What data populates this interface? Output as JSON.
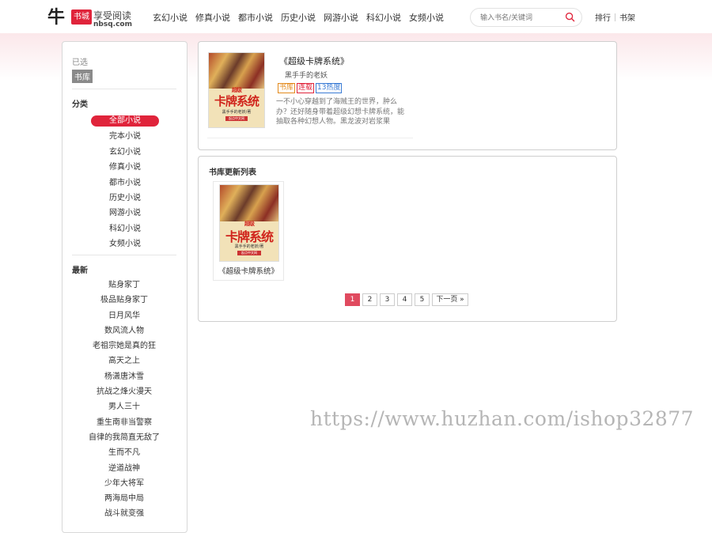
{
  "header": {
    "logo": {
      "char": "牛",
      "stamp": "书城",
      "slogan": "享受阅读",
      "domain": "nbsq.com"
    },
    "nav": [
      "玄幻小说",
      "修真小说",
      "都市小说",
      "历史小说",
      "网游小说",
      "科幻小说",
      "女频小说"
    ],
    "search": {
      "placeholder": "输入书名/关键词",
      "icon": "search-icon"
    },
    "links": {
      "rank": "排行",
      "shelf": "书架"
    }
  },
  "sidebar": {
    "selected_title": "已选",
    "selected_tag": "书库",
    "category_title": "分类",
    "categories": [
      "全部小说",
      "完本小说",
      "玄幻小说",
      "修真小说",
      "都市小说",
      "历史小说",
      "网游小说",
      "科幻小说",
      "女频小说"
    ],
    "active_category": "全部小说",
    "latest_title": "最新",
    "latest": [
      "贴身家丁",
      "极品贴身家丁",
      "日月风华",
      "数风流人物",
      "老祖宗她是真的狂",
      "高天之上",
      "杨潇唐沐雪",
      "抗战之烽火漫天",
      "男人三十",
      "重生南非当警察",
      "自律的我简直无敌了",
      "生而不凡",
      "逆道战神",
      "少年大将军",
      "两海局中局",
      "战斗就变强"
    ]
  },
  "featured": {
    "title": "《超级卡牌系统》",
    "author": "黑手手的老妖",
    "tags": [
      "书库",
      "连载",
      "13热度"
    ],
    "description": "一不小心穿越到了海贼王的世界，肿么办？还好随身带着超级幻想卡牌系统，能抽取各种幻想人物。黑龙波对岩浆果",
    "cover": {
      "top": "超级",
      "title": "卡牌系统",
      "author": "黑手手的老妖/著",
      "publisher": "起点中文网"
    }
  },
  "updates": {
    "title": "书库更新列表",
    "books": [
      {
        "name": "《超级卡牌系统》",
        "cover": {
          "top": "超级",
          "title": "卡牌系统",
          "author": "黑手手的老妖/著",
          "publisher": "起点中文网"
        }
      }
    ]
  },
  "pagination": {
    "pages": [
      "1",
      "2",
      "3",
      "4",
      "5"
    ],
    "current": "1",
    "next": "下一页 »"
  },
  "watermark": "https://www.huzhan.com/ishop32877",
  "colors": {
    "accent": "#e0243b",
    "border": "#cfcfcf",
    "pager_active": "#e04a5f"
  }
}
